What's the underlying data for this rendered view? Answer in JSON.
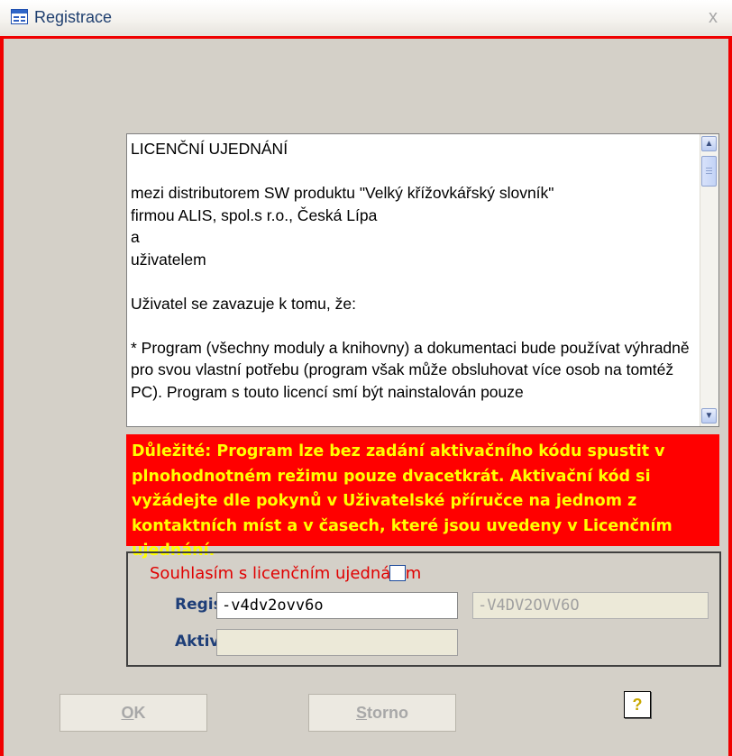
{
  "window": {
    "title": "Registrace",
    "close_symbol": "x",
    "icon": "form-icon",
    "accent_color": "#f00000"
  },
  "license": {
    "text": "LICENČNÍ UJEDNÁNÍ\n\nmezi distributorem SW produktu \"Velký křížovkářský slovník\"\nfirmou ALIS, spol.s r.o., Česká Lípa\na\nuživatelem\n\nUživatel se zavazuje k tomu, že:\n\n* Program (všechny moduly a knihovny) a dokumentaci bude používat výhradně pro svou vlastní potřebu (program však může obsluhovat více osob na tomtéž PC). Program s touto licencí smí být nainstalován pouze",
    "scroll_up_icon": "chevron-up-icon",
    "scroll_down_icon": "chevron-down-icon"
  },
  "warning": {
    "text": "Důležité: Program lze bez zadání aktivačního kódu spustit v plnohodnotném režimu pouze dvacetkrát. Aktivační kód si vyžádejte dle pokynů v Uživatelské příručce na jednom z kontaktních míst a v časech, které jsou uvedeny v Licenčním ujednání.",
    "background": "#ff0000",
    "color": "#ffff00"
  },
  "form": {
    "agree_label": "Souhlasím s licenčním ujednáním",
    "agree_checked": false,
    "reg_label": "Registrační kód:",
    "reg_value": "-v4dv2ovv6o",
    "reg_upper_value": "-V4DV2OVV6O",
    "act_label": "Aktivační kód:",
    "act_value": ""
  },
  "buttons": {
    "ok_accel": "O",
    "ok_rest": "K",
    "storno_accel": "S",
    "storno_rest": "torno",
    "help_symbol": "?",
    "help_icon": "help-icon"
  }
}
